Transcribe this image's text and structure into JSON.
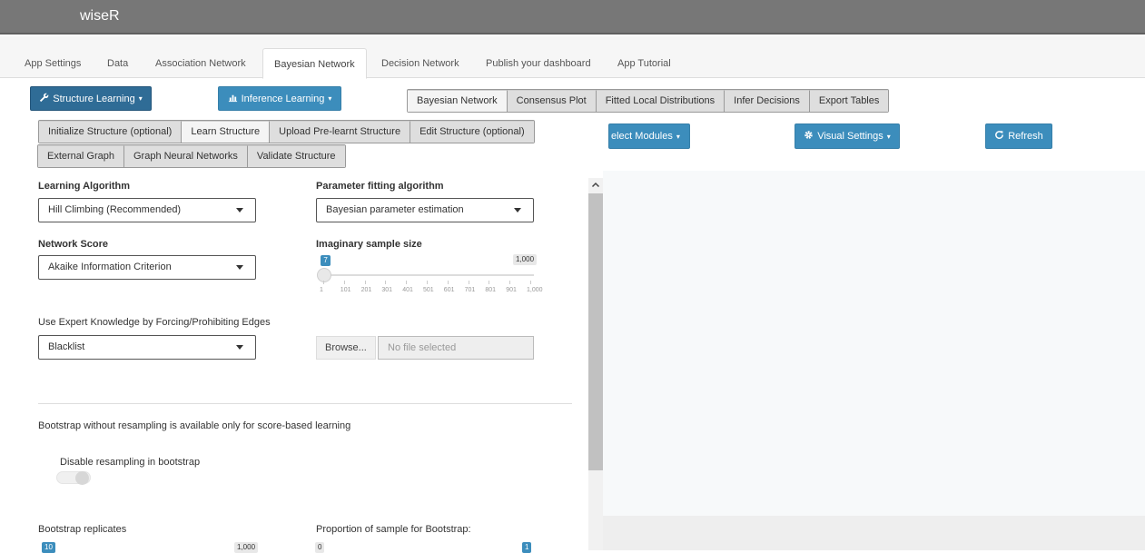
{
  "app": {
    "title": "wiseR"
  },
  "nav": {
    "tabs": [
      {
        "label": "App Settings"
      },
      {
        "label": "Data"
      },
      {
        "label": "Association Network"
      },
      {
        "label": "Bayesian Network"
      },
      {
        "label": "Decision Network"
      },
      {
        "label": "Publish your dashboard"
      },
      {
        "label": "App Tutorial"
      }
    ],
    "active": "Bayesian Network"
  },
  "toolbar": {
    "structure_learning": "Structure Learning",
    "inference_learning": "Inference Learning",
    "view_tabs": [
      {
        "label": "Bayesian Network"
      },
      {
        "label": "Consensus Plot"
      },
      {
        "label": "Fitted Local Distributions"
      },
      {
        "label": "Infer Decisions"
      },
      {
        "label": "Export Tables"
      }
    ]
  },
  "structure_tabs": {
    "row1": [
      {
        "label": "Initialize Structure (optional)"
      },
      {
        "label": "Learn Structure"
      },
      {
        "label": "Upload Pre-learnt Structure"
      },
      {
        "label": "Edit Structure (optional)"
      }
    ],
    "row2": [
      {
        "label": "External Graph"
      },
      {
        "label": "Graph Neural Networks"
      },
      {
        "label": "Validate Structure"
      }
    ]
  },
  "right_toolbar": {
    "select_modules": "elect Modules",
    "visual_settings": "Visual Settings",
    "refresh": "Refresh"
  },
  "form": {
    "learning_algorithm": {
      "label": "Learning Algorithm",
      "value": "Hill Climbing (Recommended)"
    },
    "parameter_fitting": {
      "label": "Parameter fitting algorithm",
      "value": "Bayesian parameter estimation"
    },
    "network_score": {
      "label": "Network Score",
      "value": "Akaike Information Criterion"
    },
    "imaginary_sample": {
      "label": "Imaginary sample size",
      "value": "7",
      "max_label": "1,000",
      "value_fraction": 0.006,
      "ticks": [
        "1",
        "101",
        "201",
        "301",
        "401",
        "501",
        "601",
        "701",
        "801",
        "901",
        "1,000"
      ]
    },
    "expert_knowledge": {
      "label": "Use Expert Knowledge by Forcing/Prohibiting Edges",
      "value": "Blacklist"
    },
    "file_input": {
      "browse": "Browse...",
      "placeholder": "No file selected"
    },
    "bootstrap_note": "Bootstrap without resampling is available only for score-based learning",
    "disable_resampling": {
      "label": "Disable resampling in bootstrap",
      "on": false
    },
    "bootstrap_replicates": {
      "label": "Bootstrap replicates",
      "value": "10",
      "max_label": "1,000"
    },
    "proportion": {
      "label": "Proportion of sample for Bootstrap:",
      "min_label": "0",
      "value": "1"
    }
  },
  "colors": {
    "primary": "#3c8dbc",
    "primary_dark": "#2f6c96",
    "header": "#777777"
  }
}
